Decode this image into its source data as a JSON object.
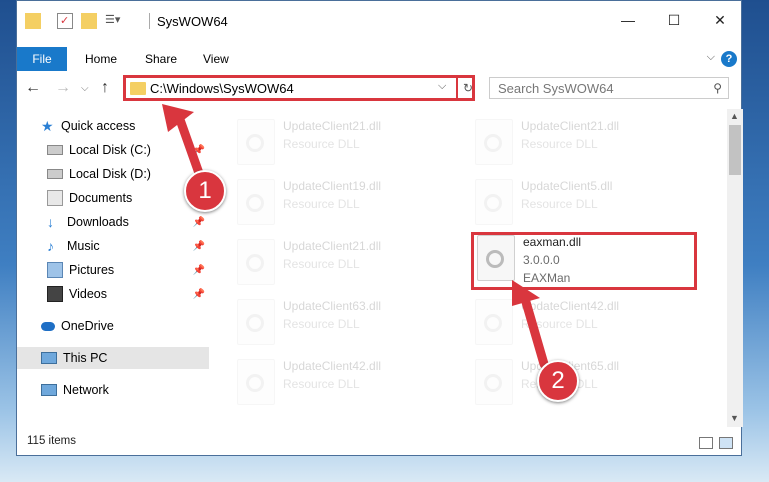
{
  "title_bar": {
    "title": "SysWOW64",
    "icons": [
      "folder-icon",
      "properties-icon",
      "new-folder-icon",
      "customize-icon"
    ],
    "controls": [
      "minimize-icon",
      "maximize-icon",
      "close-icon"
    ]
  },
  "ribbon": {
    "tabs": [
      "File",
      "Home",
      "Share",
      "View"
    ]
  },
  "nav": {
    "address": "C:\\Windows\\SysWOW64",
    "search_placeholder": "Search SysWOW64"
  },
  "sidebar": {
    "items": [
      {
        "label": "Quick access",
        "icon": "star-icon"
      },
      {
        "label": "Local Disk (C:)",
        "icon": "drive-icon",
        "pinned": true
      },
      {
        "label": "Local Disk (D:)",
        "icon": "drive-icon"
      },
      {
        "label": "Documents",
        "icon": "documents-icon",
        "pinned": true
      },
      {
        "label": "Downloads",
        "icon": "download-icon",
        "pinned": true
      },
      {
        "label": "Music",
        "icon": "music-icon",
        "pinned": true
      },
      {
        "label": "Pictures",
        "icon": "pictures-icon",
        "pinned": true
      },
      {
        "label": "Videos",
        "icon": "videos-icon",
        "pinned": true
      },
      {
        "label": "OneDrive",
        "icon": "cloud-icon"
      },
      {
        "label": "This PC",
        "icon": "computer-icon",
        "selected": true
      },
      {
        "label": "Network",
        "icon": "network-icon"
      }
    ]
  },
  "files": [
    {
      "name": "UpdateClient21.dll",
      "type": "Resource DLL"
    },
    {
      "name": "UpdateClient21.dll",
      "type": "Resource DLL"
    },
    {
      "name": "UpdateClient19.dll",
      "type": "Resource DLL"
    },
    {
      "name": "UpdateClient5.dll",
      "type": "Resource DLL"
    },
    {
      "name": "UpdateClient21.dll",
      "type": "Resource DLL"
    },
    {
      "name": "eaxman.dll",
      "type": "3.0.0.0",
      "desc": "EAXMan"
    },
    {
      "name": "UpdateClient63.dll",
      "type": "Resource DLL"
    },
    {
      "name": "UpdateClient42.dll",
      "type": "Resource DLL"
    },
    {
      "name": "UpdateClient42.dll",
      "type": "Resource DLL"
    },
    {
      "name": "UpdateClient65.dll",
      "type": "Resource DLL"
    }
  ],
  "status": {
    "item_count": "115 items"
  },
  "annotations": {
    "step1": "1",
    "step2": "2",
    "color": "#d9363e"
  }
}
